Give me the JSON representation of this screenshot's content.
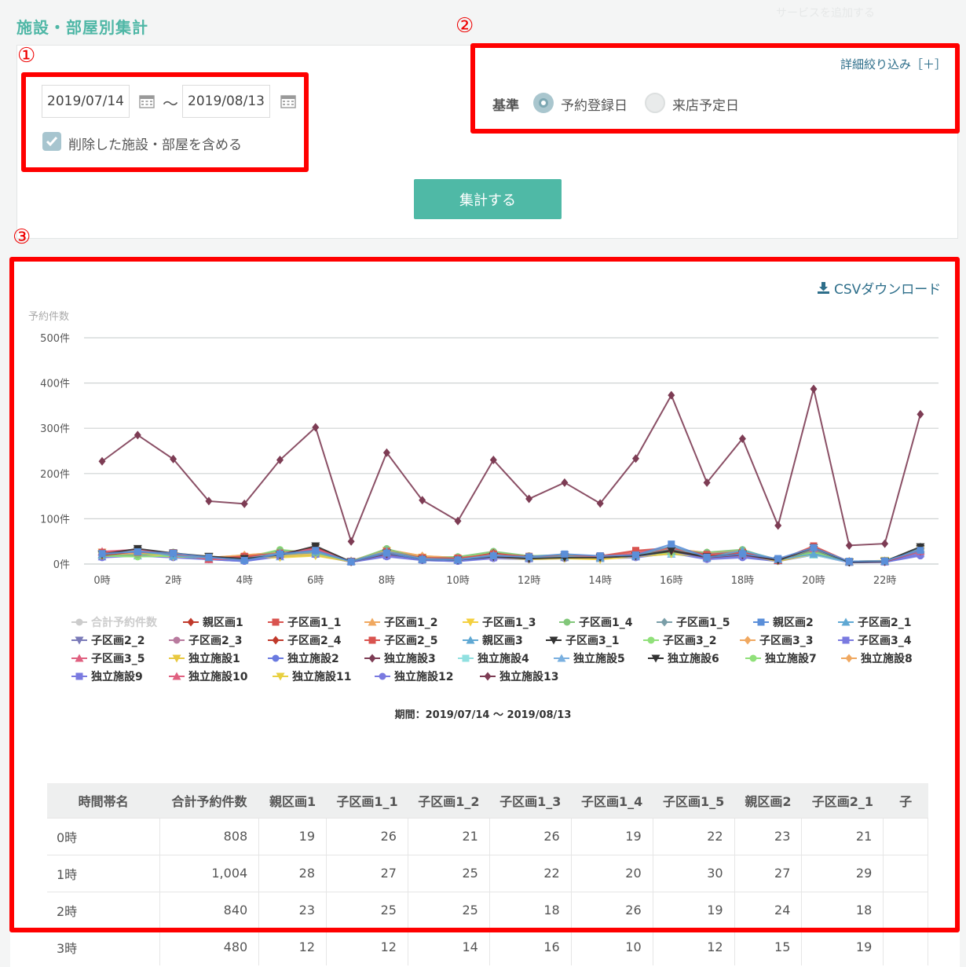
{
  "header": {
    "page_title": "施設・部屋別集計",
    "add_service": "サービスを追加する"
  },
  "annotations": {
    "n1": "①",
    "n2": "②",
    "n3": "③"
  },
  "filters": {
    "start_date": "2019/07/14",
    "end_date": "2019/08/13",
    "separator": "〜",
    "include_deleted_label": "削除した施設・部屋を含める",
    "include_deleted_checked": true,
    "detail_link": "詳細絞り込み［＋］",
    "basis_label": "基準",
    "basis_options": [
      "予約登録日",
      "来店予定日"
    ],
    "basis_selected": "予約登録日",
    "submit_label": "集計する"
  },
  "result": {
    "csv_label": "CSVダウンロード",
    "period_text": "期間：2019/07/14 〜 2019/08/13"
  },
  "colors": {
    "accent": "#4fb9a6",
    "annotation": "#ff0000",
    "link": "#2d6e8a"
  },
  "chart_data": {
    "type": "line",
    "ylabel": "予約件数",
    "y_ticks": [
      "500件",
      "400件",
      "300件",
      "200件",
      "100件",
      "0件"
    ],
    "y_tick_values": [
      500,
      400,
      300,
      200,
      100,
      0
    ],
    "ylim": [
      0,
      500
    ],
    "x_tick_labels": [
      "0時",
      "2時",
      "4時",
      "6時",
      "8時",
      "10時",
      "12時",
      "14時",
      "16時",
      "18時",
      "20時",
      "22時"
    ],
    "categories": [
      "0時",
      "1時",
      "2時",
      "3時",
      "4時",
      "5時",
      "6時",
      "7時",
      "8時",
      "9時",
      "10時",
      "11時",
      "12時",
      "13時",
      "14時",
      "15時",
      "16時",
      "17時",
      "18時",
      "19時",
      "20時",
      "21時",
      "22時",
      "23時"
    ],
    "grid": true,
    "legend_position": "bottom",
    "series": [
      {
        "name": "合計予約件数",
        "color": "#cccccc",
        "hidden": true
      },
      {
        "name": "親区画1",
        "color": "#c0392b",
        "marker": "diamond",
        "values": [
          19,
          28,
          23,
          12,
          15,
          22,
          38,
          5,
          25,
          12,
          11,
          24,
          15,
          18,
          16,
          22,
          30,
          18,
          26,
          9,
          35,
          5,
          6,
          33
        ]
      },
      {
        "name": "子区画1_1",
        "color": "#d9534f",
        "marker": "square",
        "values": [
          26,
          27,
          25,
          12,
          17,
          24,
          30,
          6,
          28,
          14,
          13,
          22,
          17,
          16,
          18,
          30,
          36,
          20,
          25,
          8,
          40,
          5,
          6,
          30
        ]
      },
      {
        "name": "子区画1_2",
        "color": "#f0a860",
        "marker": "triangle",
        "values": [
          21,
          25,
          25,
          14,
          20,
          26,
          28,
          7,
          32,
          18,
          14,
          20,
          15,
          19,
          17,
          24,
          34,
          25,
          30,
          10,
          33,
          6,
          7,
          35
        ]
      },
      {
        "name": "子区画1_3",
        "color": "#f4d03f",
        "marker": "triangle-down",
        "values": [
          26,
          22,
          18,
          16,
          12,
          18,
          22,
          5,
          30,
          15,
          12,
          18,
          12,
          16,
          10,
          20,
          30,
          20,
          24,
          7,
          30,
          5,
          8,
          32
        ]
      },
      {
        "name": "子区画1_4",
        "color": "#82c77a",
        "marker": "circle",
        "values": [
          19,
          20,
          26,
          10,
          14,
          30,
          25,
          6,
          34,
          12,
          16,
          28,
          18,
          20,
          15,
          22,
          28,
          26,
          32,
          8,
          28,
          6,
          7,
          36
        ]
      },
      {
        "name": "子区画1_5",
        "color": "#7a9ea8",
        "marker": "diamond",
        "values": [
          22,
          30,
          19,
          12,
          10,
          20,
          26,
          6,
          26,
          11,
          12,
          22,
          14,
          18,
          16,
          18,
          32,
          22,
          28,
          9,
          32,
          5,
          6,
          38
        ]
      },
      {
        "name": "親区画2",
        "color": "#5b8fd9",
        "marker": "square",
        "values": [
          23,
          27,
          24,
          15,
          8,
          22,
          30,
          5,
          24,
          10,
          9,
          18,
          16,
          22,
          18,
          20,
          44,
          15,
          22,
          12,
          36,
          6,
          7,
          30
        ]
      },
      {
        "name": "子区画2_1",
        "color": "#5fa8d3",
        "marker": "triangle",
        "values": [
          21,
          29,
          18,
          14,
          12,
          24,
          28,
          6,
          28,
          12,
          10,
          20,
          14,
          16,
          14,
          18,
          40,
          14,
          30,
          10,
          22,
          5,
          6,
          34
        ]
      },
      {
        "name": "子区画2_2",
        "color": "#7a7ab8",
        "marker": "triangle-down",
        "values": [
          22,
          24,
          20,
          16,
          10,
          20,
          26,
          5,
          22,
          10,
          8,
          16,
          12,
          20,
          16,
          18,
          26,
          16,
          22,
          8,
          28,
          4,
          5,
          28
        ]
      },
      {
        "name": "子区画2_3",
        "color": "#b87a9e",
        "marker": "circle",
        "values": [
          24,
          26,
          22,
          13,
          11,
          22,
          27,
          6,
          25,
          11,
          10,
          18,
          14,
          18,
          15,
          21,
          30,
          18,
          25,
          9,
          30,
          5,
          6,
          30
        ]
      },
      {
        "name": "子区画2_4",
        "color": "#c0392b",
        "marker": "diamond",
        "values": [
          20,
          28,
          21,
          11,
          13,
          21,
          36,
          5,
          24,
          12,
          11,
          22,
          15,
          17,
          16,
          23,
          31,
          19,
          24,
          9,
          34,
          5,
          6,
          32
        ]
      },
      {
        "name": "子区画2_5",
        "color": "#d9534f",
        "marker": "square",
        "values": [
          25,
          26,
          24,
          12,
          16,
          23,
          31,
          6,
          27,
          13,
          12,
          21,
          16,
          16,
          17,
          28,
          35,
          21,
          26,
          8,
          38,
          5,
          6,
          30
        ]
      },
      {
        "name": "親区画3",
        "color": "#5fa8d3",
        "marker": "triangle",
        "values": [
          20,
          24,
          22,
          14,
          12,
          22,
          26,
          6,
          26,
          12,
          11,
          20,
          14,
          18,
          15,
          20,
          28,
          18,
          24,
          9,
          26,
          5,
          6,
          32
        ]
      },
      {
        "name": "子区画3_1",
        "color": "#333333",
        "marker": "triangle-down",
        "values": [
          22,
          34,
          24,
          17,
          12,
          20,
          40,
          5,
          24,
          10,
          9,
          16,
          12,
          14,
          14,
          18,
          30,
          16,
          22,
          8,
          36,
          4,
          6,
          38
        ]
      },
      {
        "name": "子区画3_2",
        "color": "#90e07a",
        "marker": "circle",
        "values": [
          18,
          16,
          18,
          12,
          14,
          32,
          24,
          6,
          30,
          14,
          16,
          26,
          18,
          20,
          16,
          20,
          26,
          24,
          30,
          9,
          26,
          6,
          7,
          34
        ]
      },
      {
        "name": "子区画3_3",
        "color": "#f0a860",
        "marker": "diamond",
        "values": [
          21,
          25,
          24,
          14,
          20,
          26,
          28,
          7,
          32,
          18,
          14,
          20,
          15,
          19,
          17,
          24,
          34,
          25,
          30,
          10,
          33,
          6,
          7,
          35
        ]
      },
      {
        "name": "子区画3_4",
        "color": "#7a7ae0",
        "marker": "square",
        "values": [
          18,
          22,
          20,
          12,
          8,
          20,
          24,
          5,
          20,
          10,
          9,
          16,
          14,
          20,
          18,
          18,
          30,
          14,
          20,
          10,
          26,
          5,
          5,
          24
        ]
      },
      {
        "name": "子区画3_5",
        "color": "#e06080",
        "marker": "triangle",
        "values": [
          28,
          32,
          24,
          10,
          12,
          24,
          34,
          6,
          26,
          12,
          10,
          20,
          15,
          16,
          15,
          24,
          38,
          18,
          24,
          8,
          36,
          5,
          6,
          30
        ]
      },
      {
        "name": "独立施設1",
        "color": "#e8c840",
        "marker": "triangle-down",
        "values": [
          20,
          22,
          18,
          14,
          16,
          16,
          20,
          5,
          26,
          14,
          12,
          16,
          12,
          14,
          10,
          18,
          24,
          18,
          22,
          7,
          24,
          5,
          7,
          28
        ]
      },
      {
        "name": "独立施設2",
        "color": "#6a7ae0",
        "marker": "circle",
        "values": [
          16,
          20,
          16,
          10,
          6,
          18,
          22,
          4,
          18,
          8,
          6,
          14,
          12,
          14,
          14,
          16,
          26,
          12,
          16,
          6,
          22,
          4,
          4,
          20
        ]
      },
      {
        "name": "独立施設3",
        "color": "#7d3c54",
        "marker": "diamond",
        "values": [
          227,
          285,
          232,
          139,
          133,
          230,
          302,
          50,
          246,
          141,
          95,
          230,
          144,
          180,
          134,
          233,
          373,
          180,
          277,
          85,
          387,
          41,
          45,
          331
        ]
      },
      {
        "name": "独立施設4",
        "color": "#90e0e0",
        "marker": "square",
        "values": [
          18,
          20,
          18,
          12,
          10,
          18,
          24,
          5,
          22,
          10,
          9,
          18,
          12,
          16,
          14,
          16,
          24,
          14,
          20,
          8,
          20,
          4,
          6,
          26
        ]
      },
      {
        "name": "独立施設5",
        "color": "#7ab0e0",
        "marker": "triangle",
        "values": [
          16,
          18,
          16,
          12,
          10,
          16,
          22,
          5,
          20,
          10,
          8,
          16,
          12,
          14,
          12,
          16,
          22,
          14,
          18,
          7,
          20,
          4,
          5,
          24
        ]
      },
      {
        "name": "独立施設6",
        "color": "#333333",
        "marker": "triangle-down",
        "values": [
          22,
          30,
          22,
          16,
          12,
          20,
          36,
          5,
          24,
          10,
          9,
          18,
          12,
          16,
          14,
          18,
          28,
          16,
          22,
          8,
          32,
          4,
          6,
          34
        ]
      },
      {
        "name": "独立施設7",
        "color": "#90e07a",
        "marker": "circle",
        "values": [
          18,
          16,
          18,
          12,
          14,
          30,
          24,
          6,
          28,
          14,
          14,
          24,
          16,
          18,
          16,
          20,
          26,
          22,
          28,
          9,
          26,
          6,
          7,
          32
        ]
      },
      {
        "name": "独立施設8",
        "color": "#f0a860",
        "marker": "diamond",
        "values": [
          20,
          24,
          22,
          13,
          18,
          24,
          26,
          7,
          30,
          16,
          13,
          19,
          14,
          18,
          16,
          22,
          30,
          22,
          28,
          9,
          30,
          6,
          7,
          32
        ]
      },
      {
        "name": "独立施設9",
        "color": "#7a7ae0",
        "marker": "square",
        "values": [
          16,
          20,
          18,
          12,
          8,
          18,
          22,
          5,
          18,
          9,
          8,
          14,
          12,
          18,
          16,
          16,
          28,
          12,
          18,
          8,
          24,
          4,
          5,
          22
        ]
      },
      {
        "name": "独立施設10",
        "color": "#e06080",
        "marker": "triangle",
        "values": [
          26,
          30,
          22,
          10,
          12,
          22,
          32,
          6,
          24,
          12,
          10,
          18,
          14,
          16,
          14,
          22,
          36,
          16,
          22,
          8,
          34,
          5,
          6,
          28
        ]
      },
      {
        "name": "独立施設11",
        "color": "#e8d040",
        "marker": "triangle-down",
        "values": [
          18,
          20,
          16,
          14,
          14,
          14,
          18,
          5,
          24,
          12,
          10,
          14,
          10,
          12,
          10,
          16,
          22,
          16,
          20,
          6,
          22,
          5,
          6,
          26
        ]
      },
      {
        "name": "独立施設12",
        "color": "#7a7ae0",
        "marker": "circle",
        "values": [
          14,
          18,
          14,
          10,
          6,
          16,
          20,
          4,
          16,
          8,
          6,
          12,
          10,
          12,
          12,
          14,
          24,
          10,
          14,
          6,
          20,
          3,
          4,
          18
        ]
      },
      {
        "name": "独立施設13",
        "color": "#7d3c54",
        "marker": "diamond",
        "values": [
          20,
          26,
          20,
          12,
          10,
          20,
          28,
          5,
          22,
          11,
          9,
          18,
          12,
          16,
          14,
          18,
          30,
          14,
          20,
          8,
          30,
          4,
          5,
          28
        ]
      }
    ]
  },
  "table": {
    "columns": [
      "時間帯名",
      "合計予約件数",
      "親区画1",
      "子区画1_1",
      "子区画1_2",
      "子区画1_3",
      "子区画1_4",
      "子区画1_5",
      "親区画2",
      "子区画2_1",
      "子"
    ],
    "rows": [
      [
        "0時",
        "808",
        "19",
        "26",
        "21",
        "26",
        "19",
        "22",
        "23",
        "21",
        ""
      ],
      [
        "1時",
        "1,004",
        "28",
        "27",
        "25",
        "22",
        "20",
        "30",
        "27",
        "29",
        ""
      ],
      [
        "2時",
        "840",
        "23",
        "25",
        "25",
        "18",
        "26",
        "19",
        "24",
        "18",
        ""
      ],
      [
        "3時",
        "480",
        "12",
        "12",
        "14",
        "16",
        "10",
        "12",
        "15",
        "19",
        ""
      ]
    ]
  }
}
